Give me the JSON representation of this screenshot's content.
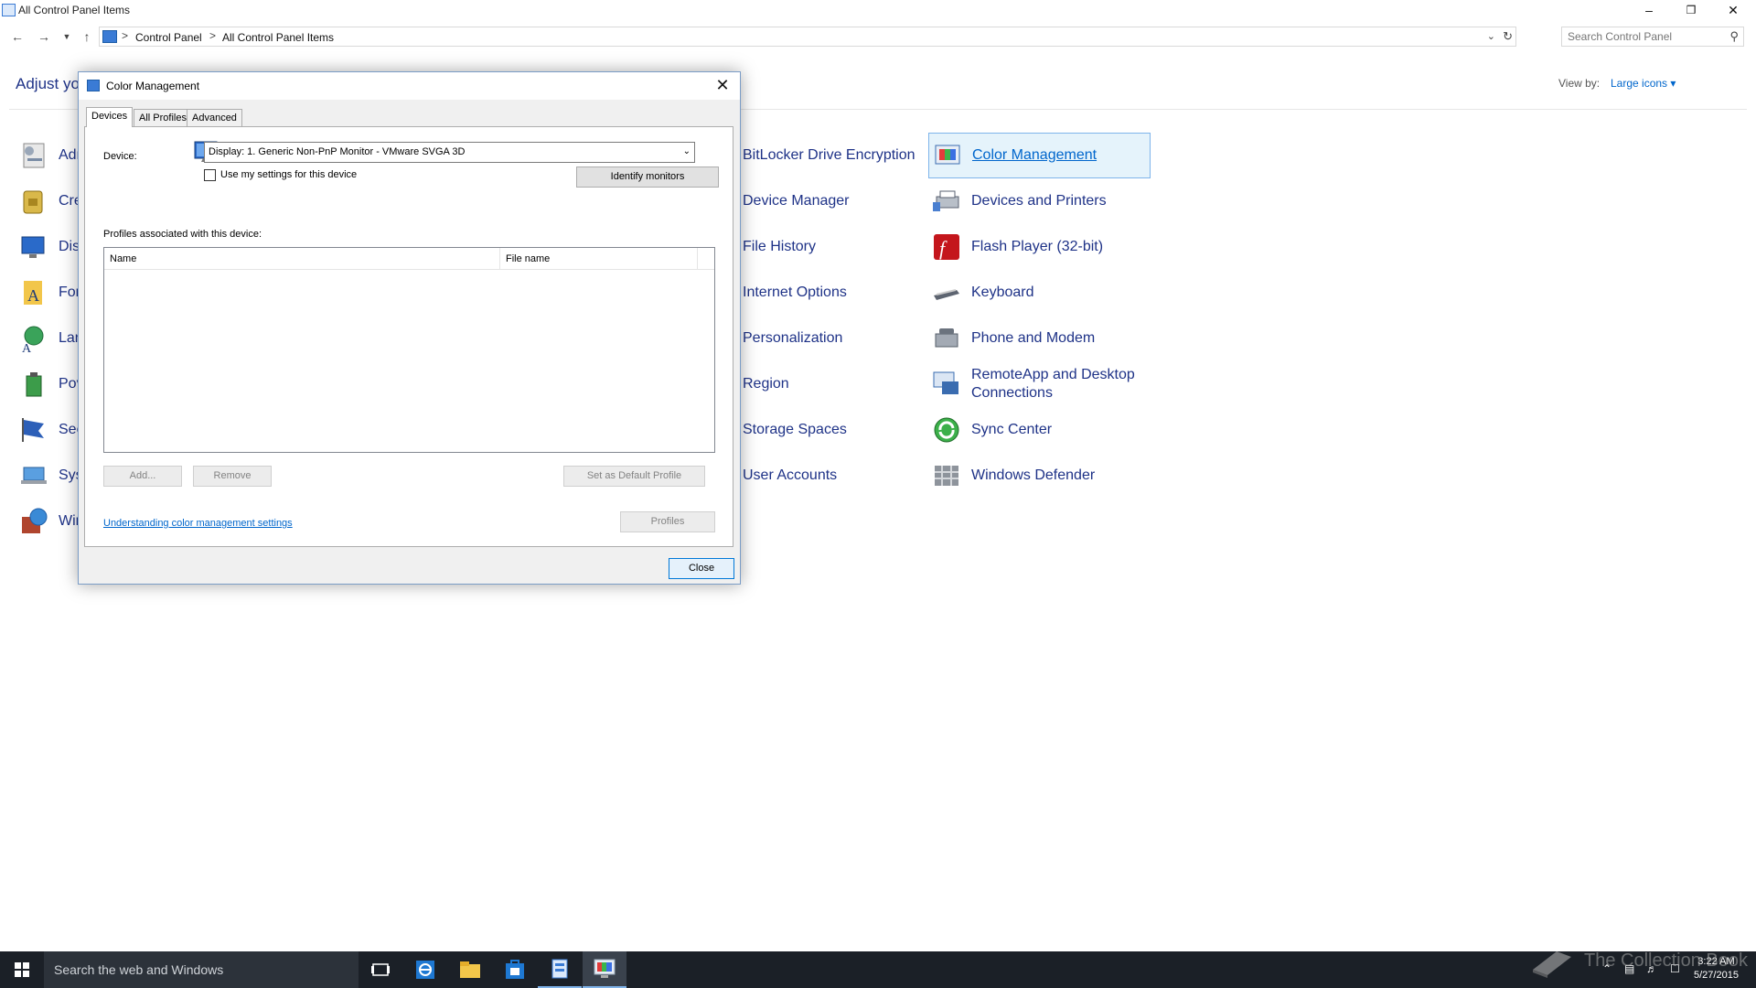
{
  "window": {
    "title": "All Control Panel Items",
    "minimize_glyph": "–",
    "maximize_glyph": "❒",
    "close_glyph": "✕"
  },
  "address": {
    "crumbs": [
      "Control Panel",
      "All Control Panel Items"
    ],
    "separator": ">",
    "search_placeholder": "Search Control Panel"
  },
  "content": {
    "heading": "Adjust you",
    "view_by_label": "View by:",
    "view_by_value": "Large icons ▾",
    "left_column_partial": [
      "Adr",
      "Cre",
      "Dis",
      "For",
      "Lan",
      "Pov",
      "Sec",
      "Sys",
      "Wir"
    ],
    "middle_column": [
      "BitLocker Drive Encryption",
      "Device Manager",
      "File History",
      "Internet Options",
      "Personalization",
      "Region",
      "Storage Spaces",
      "User Accounts"
    ],
    "right_column": [
      "Color Management",
      "Devices and Printers",
      "Flash Player (32-bit)",
      "Keyboard",
      "Phone and Modem",
      "RemoteApp and Desktop",
      "Connections",
      "Sync Center",
      "Windows Defender"
    ]
  },
  "dialog": {
    "title": "Color Management",
    "tabs": [
      "Devices",
      "All Profiles",
      "Advanced"
    ],
    "active_tab": "Devices",
    "device_label": "Device:",
    "device_value": "Display: 1. Generic Non-PnP Monitor - VMware SVGA 3D",
    "use_my_settings": "Use my settings for this device",
    "use_my_settings_checked": false,
    "identify_monitors": "Identify monitors",
    "profiles_label": "Profiles associated with this device:",
    "columns": [
      "Name",
      "File name"
    ],
    "add_button": "Add...",
    "remove_button": "Remove",
    "set_default_button": "Set as Default Profile",
    "profiles_button": "Profiles",
    "help_link": "Understanding color management settings",
    "close_button": "Close"
  },
  "taskbar": {
    "search_placeholder": "Search the web and Windows",
    "time": "3:22 AM",
    "date": "5/27/2015",
    "watermark": "The Collection Book"
  },
  "colors": {
    "link": "#1e3287",
    "accent": "#0066cc",
    "taskbar": "#1b2027",
    "selection": "#e5f3fb"
  }
}
